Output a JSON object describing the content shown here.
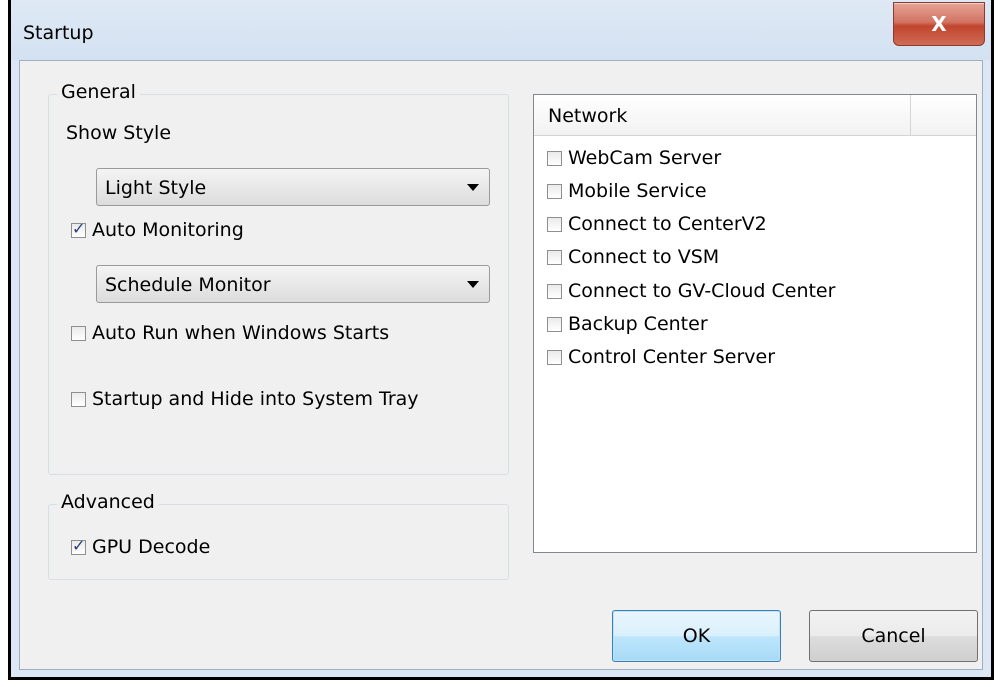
{
  "window": {
    "title": "Startup",
    "close_glyph": "X"
  },
  "general": {
    "legend": "General",
    "show_style_label": "Show Style",
    "style_select_value": "Light Style",
    "auto_monitoring": {
      "label": "Auto Monitoring",
      "checked": true
    },
    "monitor_select_value": "Schedule Monitor",
    "auto_run": {
      "label": "Auto Run when Windows Starts",
      "checked": false
    },
    "startup_hide": {
      "label": "Startup and Hide into System Tray",
      "checked": false
    }
  },
  "advanced": {
    "legend": "Advanced",
    "gpu_decode": {
      "label": "GPU Decode",
      "checked": true
    }
  },
  "network": {
    "header": "Network",
    "items": [
      {
        "label": "WebCam Server",
        "checked": false
      },
      {
        "label": "Mobile Service",
        "checked": false
      },
      {
        "label": "Connect to CenterV2",
        "checked": false
      },
      {
        "label": "Connect to VSM",
        "checked": false
      },
      {
        "label": "Connect to GV-Cloud Center",
        "checked": false
      },
      {
        "label": "Backup Center",
        "checked": false
      },
      {
        "label": "Control Center Server",
        "checked": false
      }
    ]
  },
  "buttons": {
    "ok": "OK",
    "cancel": "Cancel"
  }
}
